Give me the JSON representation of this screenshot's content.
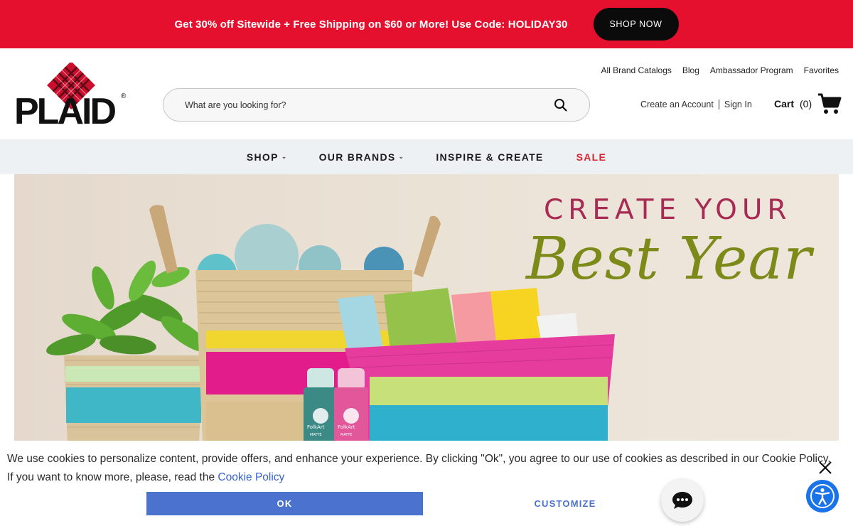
{
  "promo": {
    "text": "Get 30% off Sitewide + Free Shipping on $60 or More! Use Code: HOLIDAY30",
    "button": "SHOP NOW",
    "bg_color": "#e4102d"
  },
  "header": {
    "logo_text": "PLAID",
    "utility_links": [
      "All Brand Catalogs",
      "Blog",
      "Ambassador Program",
      "Favorites"
    ],
    "search_placeholder": "What are you looking for?",
    "create_account": "Create an Account",
    "sign_in": "Sign In",
    "cart_label": "Cart",
    "cart_count": "(0)"
  },
  "nav": {
    "items": [
      {
        "label": "SHOP",
        "has_dropdown": true
      },
      {
        "label": "OUR BRANDS",
        "has_dropdown": true
      },
      {
        "label": "INSPIRE & CREATE",
        "has_dropdown": false
      },
      {
        "label": "SALE",
        "has_dropdown": false
      }
    ],
    "sale_color": "#d9232e"
  },
  "hero": {
    "line1": "CREATE YOUR",
    "line2": "Best Year",
    "bottle_brand": "FolkArt",
    "bottle_finish": "MATTE"
  },
  "cookie": {
    "text": "We use cookies to personalize content, provide offers, and enhance your experience. By clicking \"Ok\", you agree to our use of cookies as described in our Cookie Policy. If you want to know more, please, read the ",
    "link": "Cookie Policy",
    "ok": "OK",
    "customize": "CUSTOMIZE",
    "accent_color": "#4b72cf"
  }
}
